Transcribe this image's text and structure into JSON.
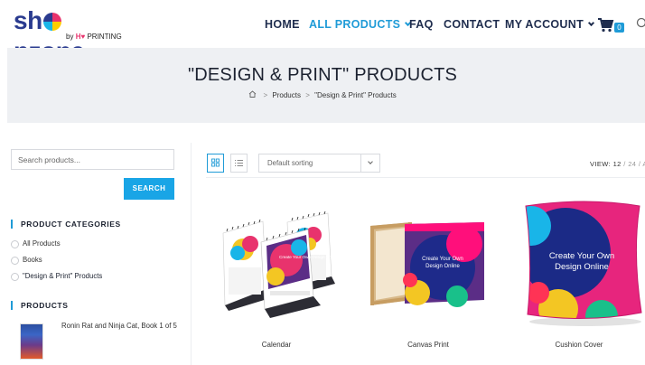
{
  "header": {
    "logo": {
      "word_start": "sh",
      "word_end": "pzone",
      "sub_prefix": "by",
      "sub_brand": "H",
      "sub_suffix": "PRINTING"
    },
    "nav": [
      {
        "label": "HOME"
      },
      {
        "label": "ALL PRODUCTS"
      },
      {
        "label": "FAQ"
      },
      {
        "label": "CONTACT"
      },
      {
        "label": "MY ACCOUNT"
      }
    ],
    "cart_count": "0",
    "colors": {
      "accent": "#1f9bd7",
      "nav": "#1f2d4e",
      "brand_pink": "#e8336d",
      "brand_navy": "#2a3b8f"
    }
  },
  "hero": {
    "title": "\"DESIGN & PRINT\" PRODUCTS",
    "breadcrumb": [
      "Products",
      "\"Design & Print\" Products"
    ],
    "home_icon": "home-icon"
  },
  "sidebar": {
    "search": {
      "placeholder": "Search products...",
      "button": "SEARCH"
    },
    "categories": {
      "title": "PRODUCT CATEGORIES",
      "items": [
        {
          "label": "All Products"
        },
        {
          "label": "Books"
        },
        {
          "label": "\"Design & Print\" Products"
        }
      ]
    },
    "products": {
      "title": "PRODUCTS",
      "items": [
        {
          "label": "Ronin Rat and Ninja Cat, Book 1 of 5"
        }
      ]
    }
  },
  "toolbar": {
    "grid_icon": "grid-view-icon",
    "list_icon": "list-view-icon",
    "sorting": "Default sorting",
    "view_label": "VIEW:",
    "view_options": [
      "12",
      "24",
      "AL"
    ]
  },
  "products": [
    {
      "name": "Calendar",
      "image_text": "Create Your Own Design Online"
    },
    {
      "name": "Canvas Print",
      "image_text_1": "Create Your Own",
      "image_text_2": "Design Online"
    },
    {
      "name": "Cushion Cover",
      "image_text_1": "Create Your Own",
      "image_text_2": "Design Online"
    }
  ]
}
